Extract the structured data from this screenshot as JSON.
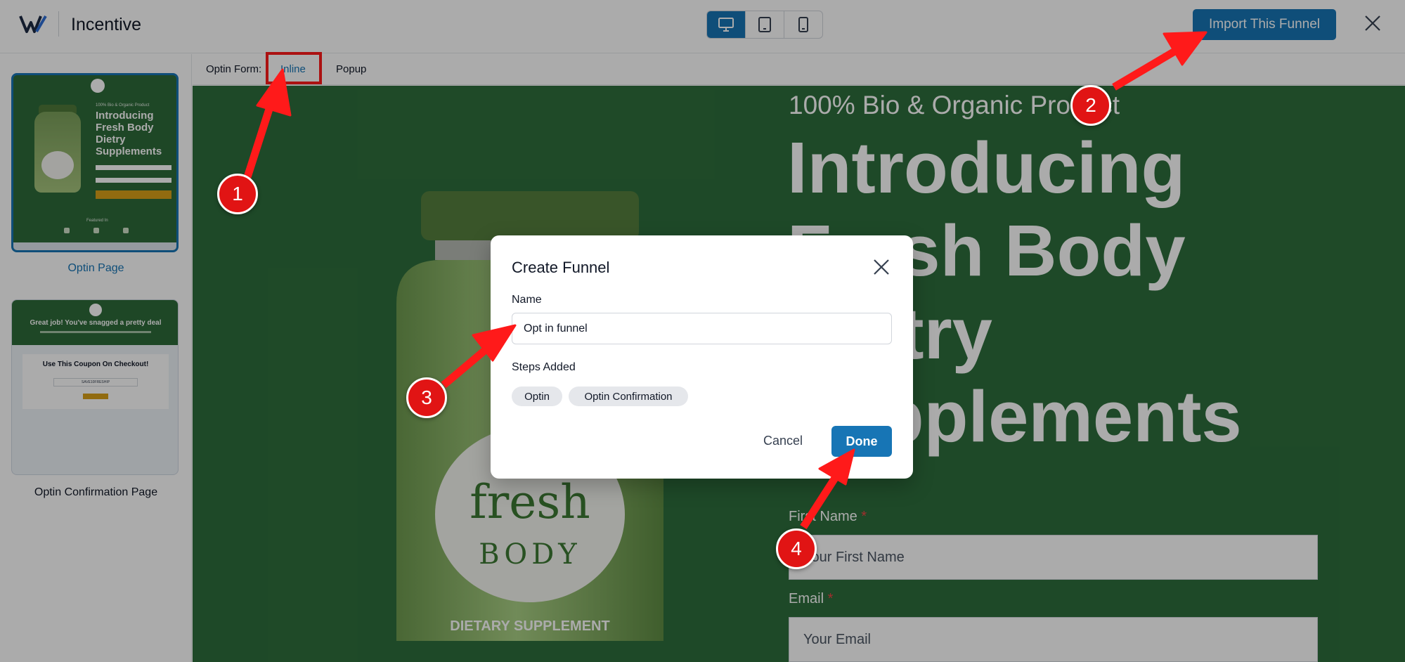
{
  "header": {
    "app_title": "Incentive",
    "import_label": "Import This Funnel",
    "devices": [
      "desktop",
      "tablet",
      "mobile"
    ],
    "active_device": "desktop"
  },
  "sidebar": {
    "pages": [
      {
        "label": "Optin Page",
        "active": true,
        "preview": {
          "kicker": "100% Bio & Organic Product",
          "headline": "Introducing Fresh Body Dietry Supplements",
          "featured": "Featured In"
        }
      },
      {
        "label": "Optin Confirmation Page",
        "active": false,
        "preview": {
          "headline": "Great job! You've snagged a pretty deal",
          "card_title": "Use This Coupon On Checkout!",
          "coupon": "SAVE10FRESHIP"
        }
      }
    ]
  },
  "optin_form": {
    "prefix": "Optin Form:",
    "tabs": [
      {
        "label": "Inline",
        "active": true
      },
      {
        "label": "Popup",
        "active": false
      }
    ]
  },
  "preview": {
    "kicker": "100% Bio & Organic Product",
    "headline": "Introducing Fresh Body Dietry Supplements",
    "bottle": {
      "brand_top": "fresh",
      "brand_bottom": "BODY",
      "caption": "DIETARY SUPPLEMENT"
    },
    "fields": [
      {
        "label": "First Name",
        "required": "*",
        "placeholder": "Your First Name"
      },
      {
        "label": "Email",
        "required": "*",
        "placeholder": "Your Email"
      }
    ]
  },
  "modal": {
    "title": "Create Funnel",
    "name_label": "Name",
    "name_value": "Opt in funnel",
    "steps_label": "Steps Added",
    "steps": [
      "Optin",
      "Optin Confirmation"
    ],
    "cancel_label": "Cancel",
    "done_label": "Done"
  },
  "annotations": {
    "markers": [
      "1",
      "2",
      "3",
      "4"
    ]
  },
  "colors": {
    "accent": "#1775b5",
    "preview_green": "#2e6e3c",
    "annotation_red": "#e11414",
    "cta_gold": "#d9a019"
  }
}
